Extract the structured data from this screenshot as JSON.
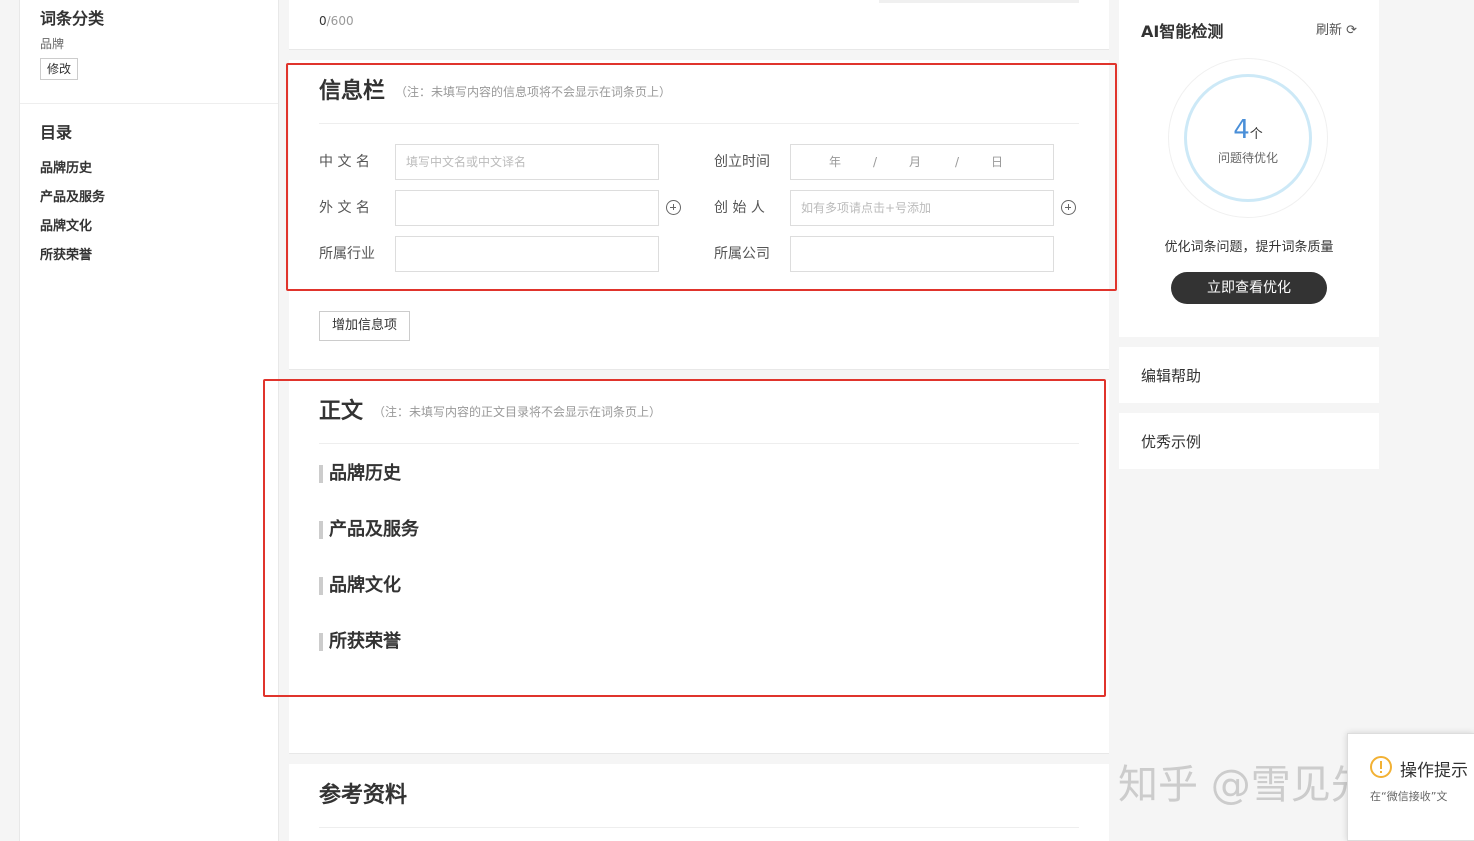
{
  "sidebar": {
    "category_title": "词条分类",
    "category_value": "品牌",
    "edit_label": "修改",
    "toc_title": "目录",
    "toc_items": [
      "品牌历史",
      "产品及服务",
      "品牌文化",
      "所获荣誉"
    ]
  },
  "top": {
    "count_current": "0",
    "count_max": "/600"
  },
  "info": {
    "title": "信息栏",
    "note": "（注：未填写内容的信息项将不会显示在词条页上）",
    "fields": {
      "chinese_name": {
        "label": "中 文 名",
        "placeholder": "填写中文名或中文译名"
      },
      "foreign_name": {
        "label": "外 文 名",
        "placeholder": ""
      },
      "industry": {
        "label": "所属行业",
        "placeholder": ""
      },
      "founded": {
        "label": "创立时间",
        "year": "年",
        "month": "月",
        "day": "日",
        "sep": "/"
      },
      "founder": {
        "label": "创 始 人",
        "placeholder": "如有多项请点击+号添加"
      },
      "company": {
        "label": "所属公司",
        "placeholder": ""
      }
    },
    "add_button": "增加信息项"
  },
  "body": {
    "title": "正文",
    "note": "（注：未填写内容的正文目录将不会显示在词条页上）",
    "sections": [
      "品牌历史",
      "产品及服务",
      "品牌文化",
      "所获荣誉"
    ]
  },
  "reference": {
    "title": "参考资料"
  },
  "ai": {
    "title": "AI智能检测",
    "refresh": "刷新",
    "count": "4",
    "unit": "个",
    "ring_text": "问题待优化",
    "desc": "优化词条问题，提升词条质量",
    "button": "立即查看优化"
  },
  "help": {
    "label": "编辑帮助"
  },
  "examples": {
    "label": "优秀示例"
  },
  "watermark": "知乎 @雪见先生",
  "toast": {
    "title": "操作提示",
    "text": "在“微信接收”文"
  },
  "colors": {
    "highlight": "#e0342c",
    "ring": "#cde9f7",
    "ring_number": "#4a8fd8",
    "dark_button": "#333333"
  }
}
